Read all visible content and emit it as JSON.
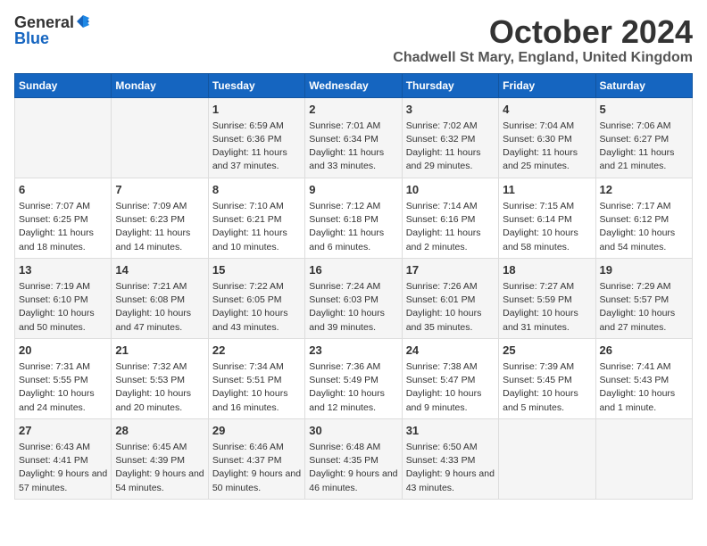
{
  "logo": {
    "general": "General",
    "blue": "Blue"
  },
  "title": {
    "month": "October 2024",
    "location": "Chadwell St Mary, England, United Kingdom"
  },
  "days_of_week": [
    "Sunday",
    "Monday",
    "Tuesday",
    "Wednesday",
    "Thursday",
    "Friday",
    "Saturday"
  ],
  "weeks": [
    [
      {
        "day": "",
        "content": ""
      },
      {
        "day": "",
        "content": ""
      },
      {
        "day": "1",
        "content": "Sunrise: 6:59 AM\nSunset: 6:36 PM\nDaylight: 11 hours and 37 minutes."
      },
      {
        "day": "2",
        "content": "Sunrise: 7:01 AM\nSunset: 6:34 PM\nDaylight: 11 hours and 33 minutes."
      },
      {
        "day": "3",
        "content": "Sunrise: 7:02 AM\nSunset: 6:32 PM\nDaylight: 11 hours and 29 minutes."
      },
      {
        "day": "4",
        "content": "Sunrise: 7:04 AM\nSunset: 6:30 PM\nDaylight: 11 hours and 25 minutes."
      },
      {
        "day": "5",
        "content": "Sunrise: 7:06 AM\nSunset: 6:27 PM\nDaylight: 11 hours and 21 minutes."
      }
    ],
    [
      {
        "day": "6",
        "content": "Sunrise: 7:07 AM\nSunset: 6:25 PM\nDaylight: 11 hours and 18 minutes."
      },
      {
        "day": "7",
        "content": "Sunrise: 7:09 AM\nSunset: 6:23 PM\nDaylight: 11 hours and 14 minutes."
      },
      {
        "day": "8",
        "content": "Sunrise: 7:10 AM\nSunset: 6:21 PM\nDaylight: 11 hours and 10 minutes."
      },
      {
        "day": "9",
        "content": "Sunrise: 7:12 AM\nSunset: 6:18 PM\nDaylight: 11 hours and 6 minutes."
      },
      {
        "day": "10",
        "content": "Sunrise: 7:14 AM\nSunset: 6:16 PM\nDaylight: 11 hours and 2 minutes."
      },
      {
        "day": "11",
        "content": "Sunrise: 7:15 AM\nSunset: 6:14 PM\nDaylight: 10 hours and 58 minutes."
      },
      {
        "day": "12",
        "content": "Sunrise: 7:17 AM\nSunset: 6:12 PM\nDaylight: 10 hours and 54 minutes."
      }
    ],
    [
      {
        "day": "13",
        "content": "Sunrise: 7:19 AM\nSunset: 6:10 PM\nDaylight: 10 hours and 50 minutes."
      },
      {
        "day": "14",
        "content": "Sunrise: 7:21 AM\nSunset: 6:08 PM\nDaylight: 10 hours and 47 minutes."
      },
      {
        "day": "15",
        "content": "Sunrise: 7:22 AM\nSunset: 6:05 PM\nDaylight: 10 hours and 43 minutes."
      },
      {
        "day": "16",
        "content": "Sunrise: 7:24 AM\nSunset: 6:03 PM\nDaylight: 10 hours and 39 minutes."
      },
      {
        "day": "17",
        "content": "Sunrise: 7:26 AM\nSunset: 6:01 PM\nDaylight: 10 hours and 35 minutes."
      },
      {
        "day": "18",
        "content": "Sunrise: 7:27 AM\nSunset: 5:59 PM\nDaylight: 10 hours and 31 minutes."
      },
      {
        "day": "19",
        "content": "Sunrise: 7:29 AM\nSunset: 5:57 PM\nDaylight: 10 hours and 27 minutes."
      }
    ],
    [
      {
        "day": "20",
        "content": "Sunrise: 7:31 AM\nSunset: 5:55 PM\nDaylight: 10 hours and 24 minutes."
      },
      {
        "day": "21",
        "content": "Sunrise: 7:32 AM\nSunset: 5:53 PM\nDaylight: 10 hours and 20 minutes."
      },
      {
        "day": "22",
        "content": "Sunrise: 7:34 AM\nSunset: 5:51 PM\nDaylight: 10 hours and 16 minutes."
      },
      {
        "day": "23",
        "content": "Sunrise: 7:36 AM\nSunset: 5:49 PM\nDaylight: 10 hours and 12 minutes."
      },
      {
        "day": "24",
        "content": "Sunrise: 7:38 AM\nSunset: 5:47 PM\nDaylight: 10 hours and 9 minutes."
      },
      {
        "day": "25",
        "content": "Sunrise: 7:39 AM\nSunset: 5:45 PM\nDaylight: 10 hours and 5 minutes."
      },
      {
        "day": "26",
        "content": "Sunrise: 7:41 AM\nSunset: 5:43 PM\nDaylight: 10 hours and 1 minute."
      }
    ],
    [
      {
        "day": "27",
        "content": "Sunrise: 6:43 AM\nSunset: 4:41 PM\nDaylight: 9 hours and 57 minutes."
      },
      {
        "day": "28",
        "content": "Sunrise: 6:45 AM\nSunset: 4:39 PM\nDaylight: 9 hours and 54 minutes."
      },
      {
        "day": "29",
        "content": "Sunrise: 6:46 AM\nSunset: 4:37 PM\nDaylight: 9 hours and 50 minutes."
      },
      {
        "day": "30",
        "content": "Sunrise: 6:48 AM\nSunset: 4:35 PM\nDaylight: 9 hours and 46 minutes."
      },
      {
        "day": "31",
        "content": "Sunrise: 6:50 AM\nSunset: 4:33 PM\nDaylight: 9 hours and 43 minutes."
      },
      {
        "day": "",
        "content": ""
      },
      {
        "day": "",
        "content": ""
      }
    ]
  ]
}
